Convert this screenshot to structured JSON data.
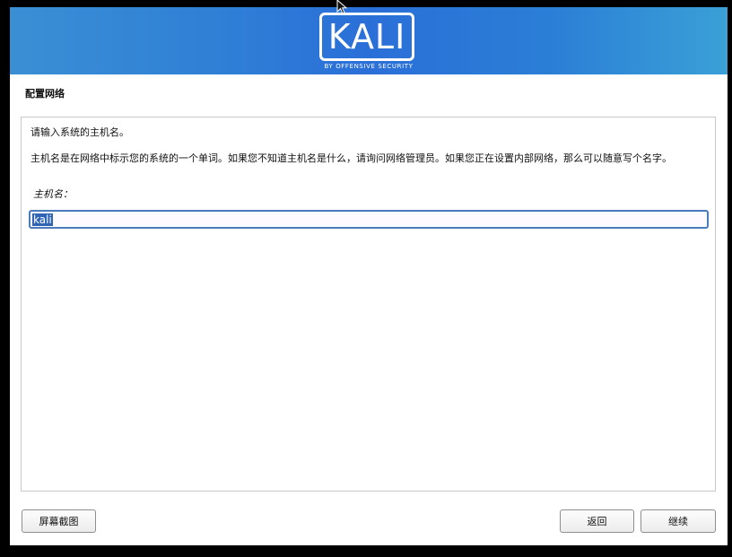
{
  "banner": {
    "logo_text": "KALI",
    "logo_subtitle": "BY OFFENSIVE SECURITY"
  },
  "page_title": "配置网络",
  "content": {
    "prompt": "请输入系统的主机名。",
    "description": "主机名是在网络中标示您的系统的一个单词。如果您不知道主机名是什么，请询问网络管理员。如果您正在设置内部网络，那么可以随意写个名字。",
    "field_label": "主机名：",
    "hostname_value": "kali"
  },
  "buttons": {
    "screenshot": "屏幕截图",
    "back": "返回",
    "continue": "继续"
  },
  "colors": {
    "banner_accent": "#2a6fd8",
    "selection": "#2f64b5",
    "input_border": "#4a7bbd"
  },
  "icons": [
    "mouse-pointer-icon"
  ]
}
